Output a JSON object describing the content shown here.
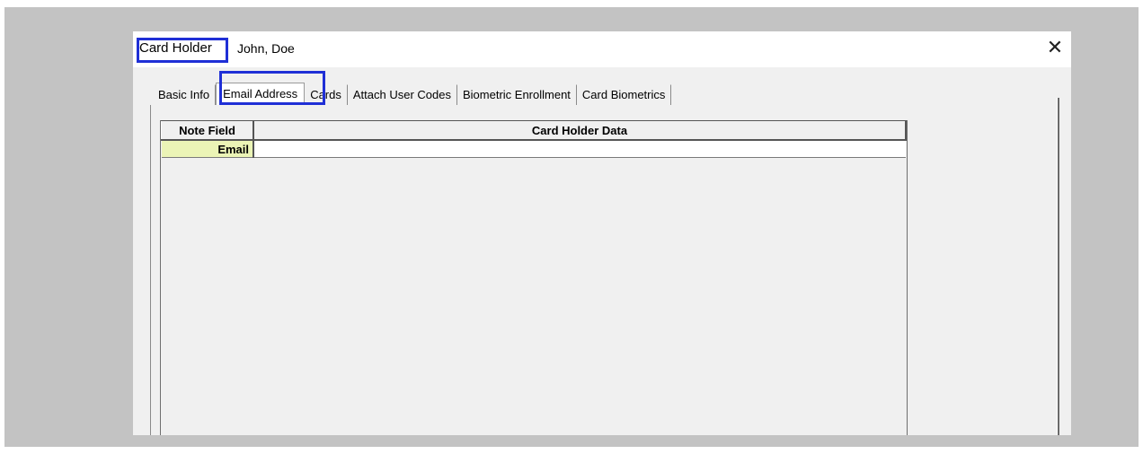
{
  "window": {
    "title_label": "Card Holder",
    "title_value": "John, Doe",
    "close_glyph": "✕"
  },
  "tabs": [
    {
      "label": "Basic Info",
      "active": false
    },
    {
      "label": "Email Address",
      "active": true
    },
    {
      "label": "Cards",
      "active": false
    },
    {
      "label": "Attach User Codes",
      "active": false
    },
    {
      "label": "Biometric Enrollment",
      "active": false
    },
    {
      "label": "Card Biometrics",
      "active": false
    }
  ],
  "grid": {
    "headers": [
      "Note Field",
      "Card Holder Data"
    ],
    "rows": [
      {
        "field": "Email",
        "value": ""
      }
    ]
  },
  "colors": {
    "highlight": "#1f2fd6",
    "field_cell_bg": "#ebf4b6",
    "panel_bg": "#f0f0f0",
    "frame_bg": "#c3c3c3"
  },
  "icons": {
    "close": "close-icon"
  }
}
